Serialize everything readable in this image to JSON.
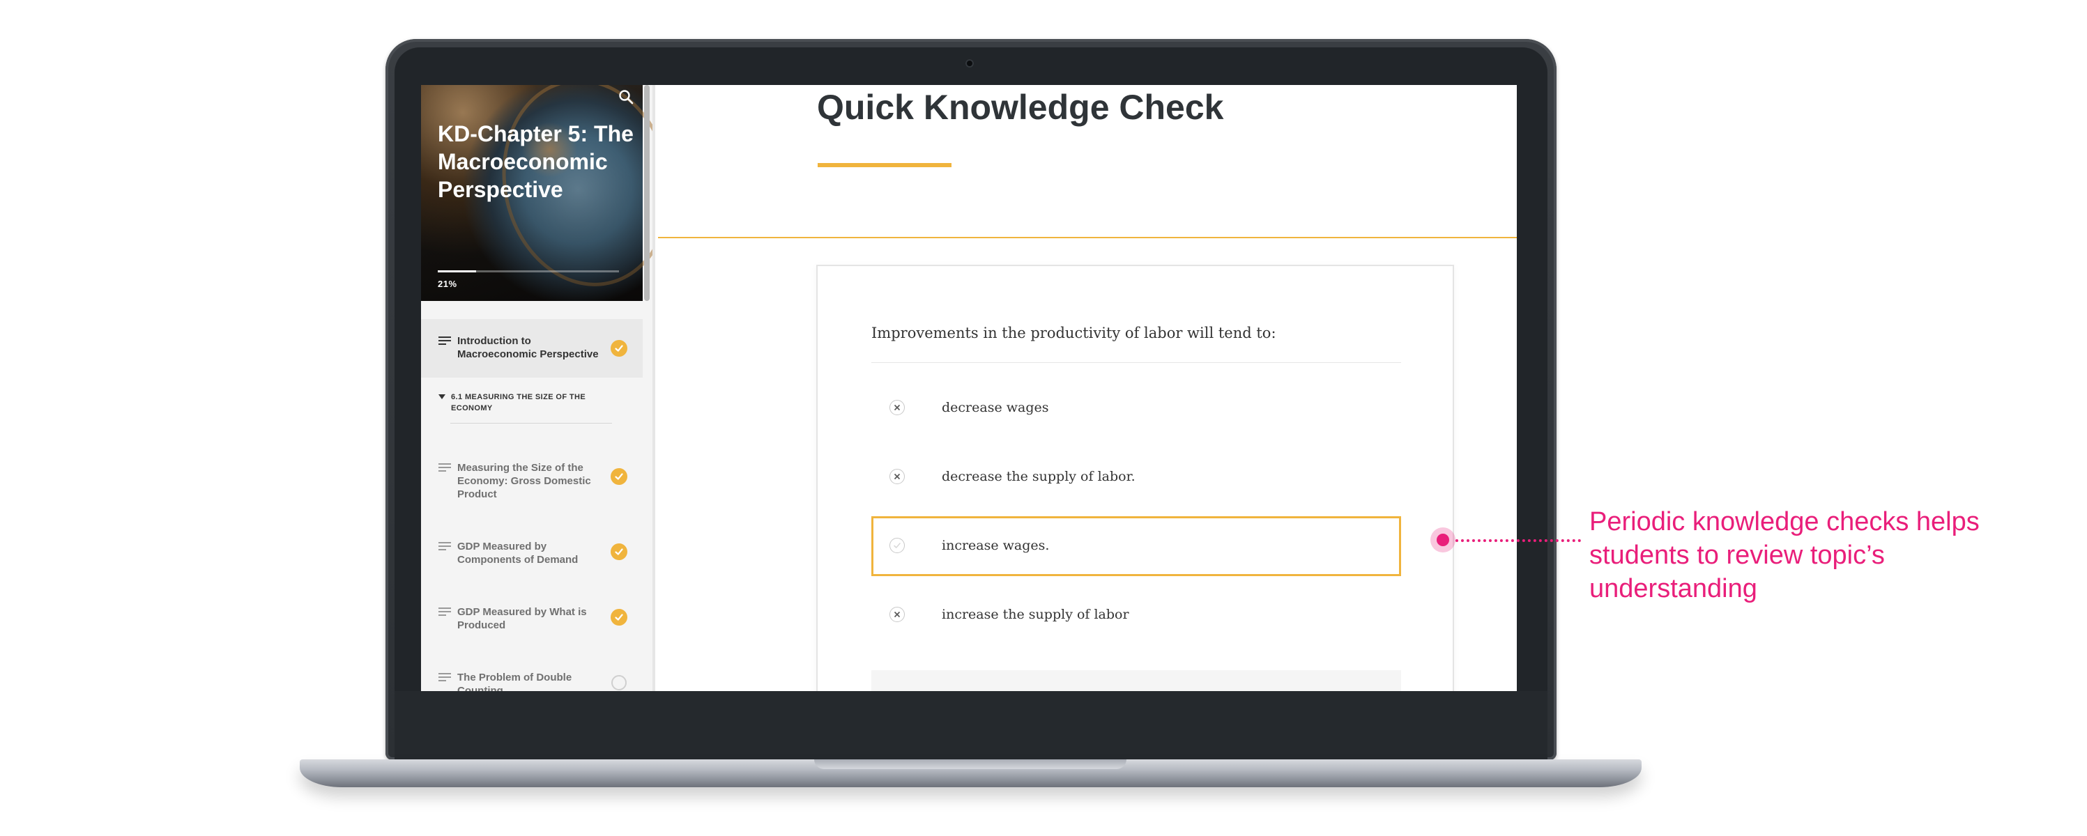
{
  "course": {
    "title": "KD-Chapter 5: The Macroeconomic Perspective",
    "progress_text": "21%",
    "progress_value": 0.21
  },
  "sidebar": {
    "search_icon": "search-icon",
    "items": [
      {
        "label": "Introduction to Macroeconomic Perspective",
        "status": "complete",
        "active": true
      }
    ],
    "section": {
      "label": "6.1 MEASURING THE SIZE OF THE ECONOMY",
      "expanded": true
    },
    "section_items": [
      {
        "label": "Measuring the Size of the Economy: Gross Domestic Product",
        "status": "complete"
      },
      {
        "label": "GDP Measured by Components of Demand",
        "status": "complete"
      },
      {
        "label": "GDP Measured by What is Produced",
        "status": "complete"
      },
      {
        "label": "The Problem of Double Counting",
        "status": "incomplete"
      }
    ]
  },
  "main": {
    "title": "Quick Knowledge Check",
    "question": "Improvements in the productivity of labor will tend to:",
    "options": [
      {
        "text": "decrease wages",
        "icon": "x-icon",
        "selected": false
      },
      {
        "text": "decrease the supply of labor.",
        "icon": "x-icon",
        "selected": false
      },
      {
        "text": "increase wages.",
        "icon": "check-icon",
        "selected": true
      },
      {
        "text": "increase the supply of labor",
        "icon": "x-icon",
        "selected": false
      }
    ]
  },
  "callout": {
    "text": "Periodic knowledge checks helps students to review topic’s understanding"
  },
  "colors": {
    "accent": "#f0b43d",
    "callout": "#e91e7a",
    "device": "#2c3034"
  }
}
